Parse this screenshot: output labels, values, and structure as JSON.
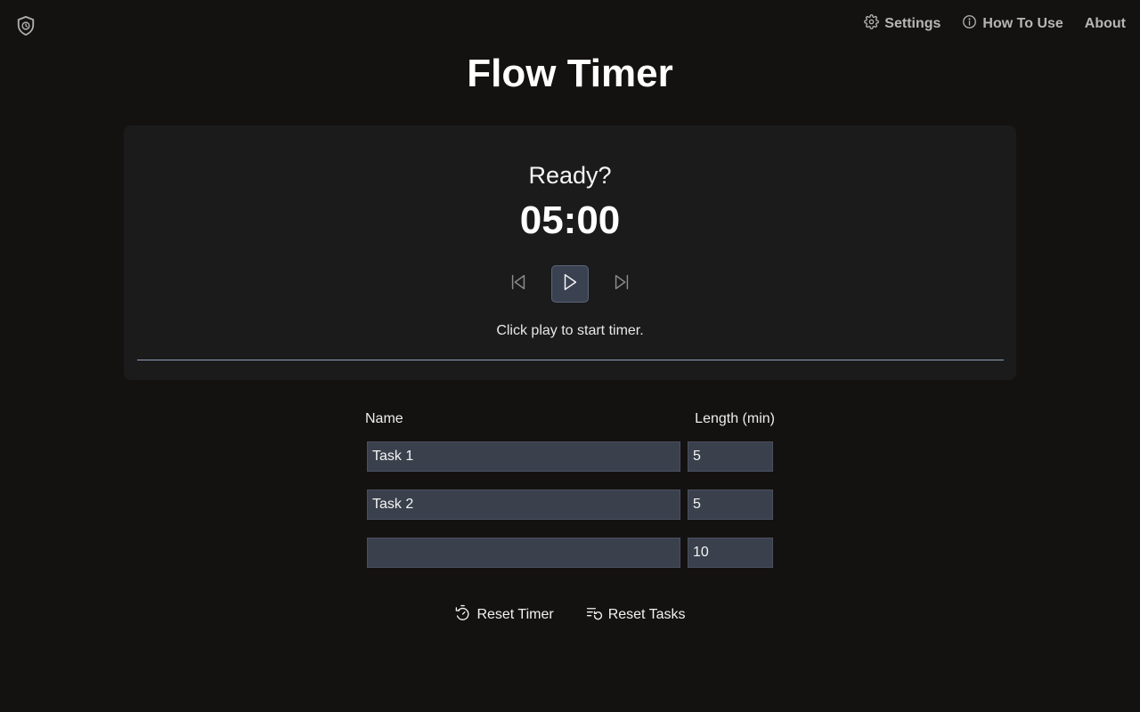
{
  "nav": {
    "items": [
      {
        "label": "Settings",
        "icon": "gear-icon"
      },
      {
        "label": "How To Use",
        "icon": "info-icon"
      },
      {
        "label": "About"
      }
    ]
  },
  "page": {
    "title": "Flow Timer"
  },
  "timer": {
    "status": "Ready?",
    "time": "05:00",
    "hint": "Click play to start timer.",
    "controls": [
      "skip-back-icon",
      "play-icon",
      "skip-forward-icon"
    ]
  },
  "tasks": {
    "headers": {
      "name": "Name",
      "length": "Length (min)"
    },
    "rows": [
      {
        "name": "Task 1",
        "length": "5"
      },
      {
        "name": "Task 2",
        "length": "5"
      },
      {
        "name": "",
        "length": "10"
      }
    ]
  },
  "actions": {
    "reset_timer": "Reset Timer",
    "reset_tasks": "Reset Tasks"
  },
  "colors": {
    "background": "#141211",
    "panel": "#1b1b1c",
    "input": "#3a404c",
    "accent_line": "#8aa2b8"
  }
}
